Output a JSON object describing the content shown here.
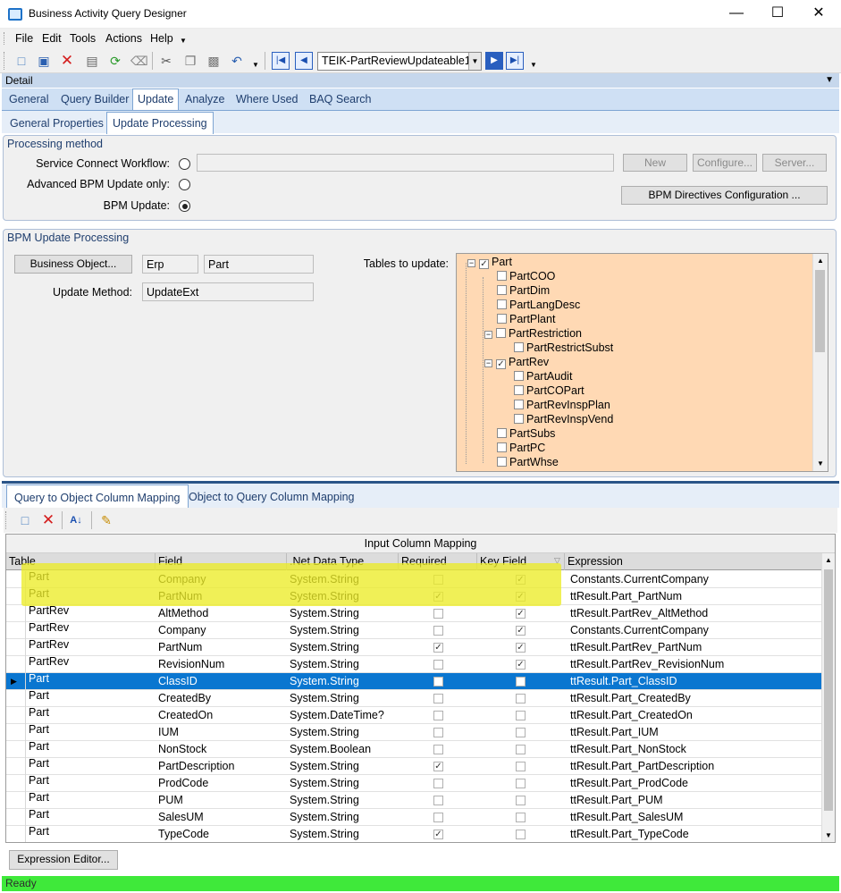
{
  "window": {
    "title": "Business Activity Query Designer"
  },
  "menu": [
    "File",
    "Edit",
    "Tools",
    "Actions",
    "Help"
  ],
  "toolbar": {
    "dataset": "TEIK-PartReviewUpdateable1"
  },
  "detail_header": "Detail",
  "main_tabs": [
    "General",
    "Query Builder",
    "Update",
    "Analyze",
    "Where Used",
    "BAQ Search"
  ],
  "sub_tabs": [
    "General Properties",
    "Update  Processing"
  ],
  "processing": {
    "title": "Processing method",
    "service_label": "Service Connect Workflow:",
    "advanced_label": "Advanced BPM Update only:",
    "bpm_label": "BPM Update:",
    "new_btn": "New",
    "configure_btn": "Configure...",
    "server_btn": "Server...",
    "bpm_directives_btn": "BPM Directives Configuration ..."
  },
  "bpm_processing": {
    "title": "BPM Update Processing",
    "business_object_btn": "Business Object...",
    "bo_namespace": "Erp",
    "bo_name": "Part",
    "update_method_label": "Update Method:",
    "update_method": "UpdateExt",
    "tables_label": "Tables to update:"
  },
  "tree": [
    {
      "label": "Part",
      "checked": true,
      "level": 0,
      "expander": "-"
    },
    {
      "label": "PartCOO",
      "checked": false,
      "level": 1
    },
    {
      "label": "PartDim",
      "checked": false,
      "level": 1
    },
    {
      "label": "PartLangDesc",
      "checked": false,
      "level": 1
    },
    {
      "label": "PartPlant",
      "checked": false,
      "level": 1
    },
    {
      "label": "PartRestriction",
      "checked": false,
      "level": 1,
      "expander": "-"
    },
    {
      "label": "PartRestrictSubst",
      "checked": false,
      "level": 2
    },
    {
      "label": "PartRev",
      "checked": true,
      "level": 1,
      "expander": "-"
    },
    {
      "label": "PartAudit",
      "checked": false,
      "level": 2
    },
    {
      "label": "PartCOPart",
      "checked": false,
      "level": 2
    },
    {
      "label": "PartRevInspPlan",
      "checked": false,
      "level": 2
    },
    {
      "label": "PartRevInspVend",
      "checked": false,
      "level": 2
    },
    {
      "label": "PartSubs",
      "checked": false,
      "level": 1
    },
    {
      "label": "PartPC",
      "checked": false,
      "level": 1
    },
    {
      "label": "PartWhse",
      "checked": false,
      "level": 1
    }
  ],
  "lower_tabs": [
    "Query to Object Column Mapping",
    "Object to Query Column Mapping"
  ],
  "grid": {
    "title": "Input Column Mapping",
    "headers": [
      "Table",
      "Field",
      ".Net Data Type",
      "Required",
      "Key Field",
      "Expression"
    ],
    "rows": [
      {
        "table": "Part",
        "field": "Company",
        "type": "System.String",
        "required": false,
        "key": true,
        "expr": "Constants.CurrentCompany"
      },
      {
        "table": "Part",
        "field": "PartNum",
        "type": "System.String",
        "required": true,
        "key": true,
        "expr": "ttResult.Part_PartNum"
      },
      {
        "table": "PartRev",
        "field": "AltMethod",
        "type": "System.String",
        "required": false,
        "key": true,
        "expr": "ttResult.PartRev_AltMethod"
      },
      {
        "table": "PartRev",
        "field": "Company",
        "type": "System.String",
        "required": false,
        "key": true,
        "expr": "Constants.CurrentCompany"
      },
      {
        "table": "PartRev",
        "field": "PartNum",
        "type": "System.String",
        "required": true,
        "key": true,
        "expr": "ttResult.PartRev_PartNum"
      },
      {
        "table": "PartRev",
        "field": "RevisionNum",
        "type": "System.String",
        "required": false,
        "key": true,
        "expr": "ttResult.PartRev_RevisionNum"
      },
      {
        "table": "Part",
        "field": "ClassID",
        "type": "System.String",
        "required": false,
        "key": false,
        "expr": "ttResult.Part_ClassID",
        "selected": true
      },
      {
        "table": "Part",
        "field": "CreatedBy",
        "type": "System.String",
        "required": false,
        "key": false,
        "expr": "ttResult.Part_CreatedBy"
      },
      {
        "table": "Part",
        "field": "CreatedOn",
        "type": "System.DateTime?",
        "required": false,
        "key": false,
        "expr": "ttResult.Part_CreatedOn"
      },
      {
        "table": "Part",
        "field": "IUM",
        "type": "System.String",
        "required": false,
        "key": false,
        "expr": "ttResult.Part_IUM"
      },
      {
        "table": "Part",
        "field": "NonStock",
        "type": "System.Boolean",
        "required": false,
        "key": false,
        "expr": "ttResult.Part_NonStock"
      },
      {
        "table": "Part",
        "field": "PartDescription",
        "type": "System.String",
        "required": true,
        "key": false,
        "expr": "ttResult.Part_PartDescription"
      },
      {
        "table": "Part",
        "field": "ProdCode",
        "type": "System.String",
        "required": false,
        "key": false,
        "expr": "ttResult.Part_ProdCode"
      },
      {
        "table": "Part",
        "field": "PUM",
        "type": "System.String",
        "required": false,
        "key": false,
        "expr": "ttResult.Part_PUM"
      },
      {
        "table": "Part",
        "field": "SalesUM",
        "type": "System.String",
        "required": false,
        "key": false,
        "expr": "ttResult.Part_SalesUM"
      },
      {
        "table": "Part",
        "field": "TypeCode",
        "type": "System.String",
        "required": true,
        "key": false,
        "expr": "ttResult.Part_TypeCode"
      }
    ]
  },
  "expression_editor_btn": "Expression Editor...",
  "status": "Ready",
  "colors": {
    "status_bar": "#3fe93a",
    "tree_bg": "#ffd9b4",
    "selected_row": "#0a76d0",
    "highlight": "#ecec28"
  }
}
